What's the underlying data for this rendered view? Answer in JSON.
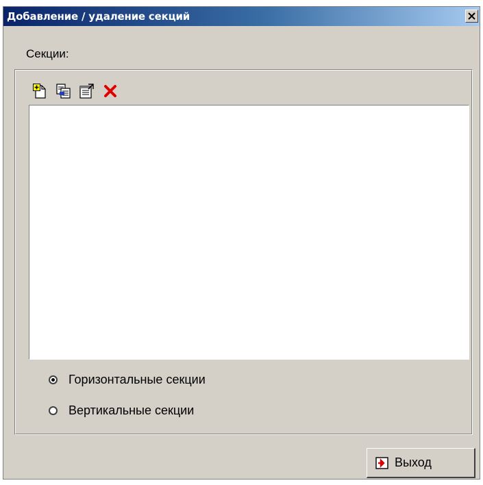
{
  "window": {
    "title": "Добавление / удаление секций",
    "close_glyph": "x",
    "colors": {
      "title_start": "#0a246a",
      "title_end": "#a6caf0",
      "face": "#d4d0c8"
    }
  },
  "sections": {
    "label": "Секции:",
    "toolbar": [
      {
        "name": "add-section-button",
        "icon": "add-page-icon"
      },
      {
        "name": "copy-section-button",
        "icon": "copy-page-icon"
      },
      {
        "name": "section-properties-button",
        "icon": "properties-icon"
      },
      {
        "name": "delete-section-button",
        "icon": "delete-icon"
      }
    ],
    "items": []
  },
  "orientation": {
    "options": [
      {
        "label": "Горизонтальные секции",
        "checked": true
      },
      {
        "label": "Вертикальные секции",
        "checked": false
      }
    ]
  },
  "footer": {
    "exit_label": "Выход",
    "exit_icon": "exit-icon"
  }
}
